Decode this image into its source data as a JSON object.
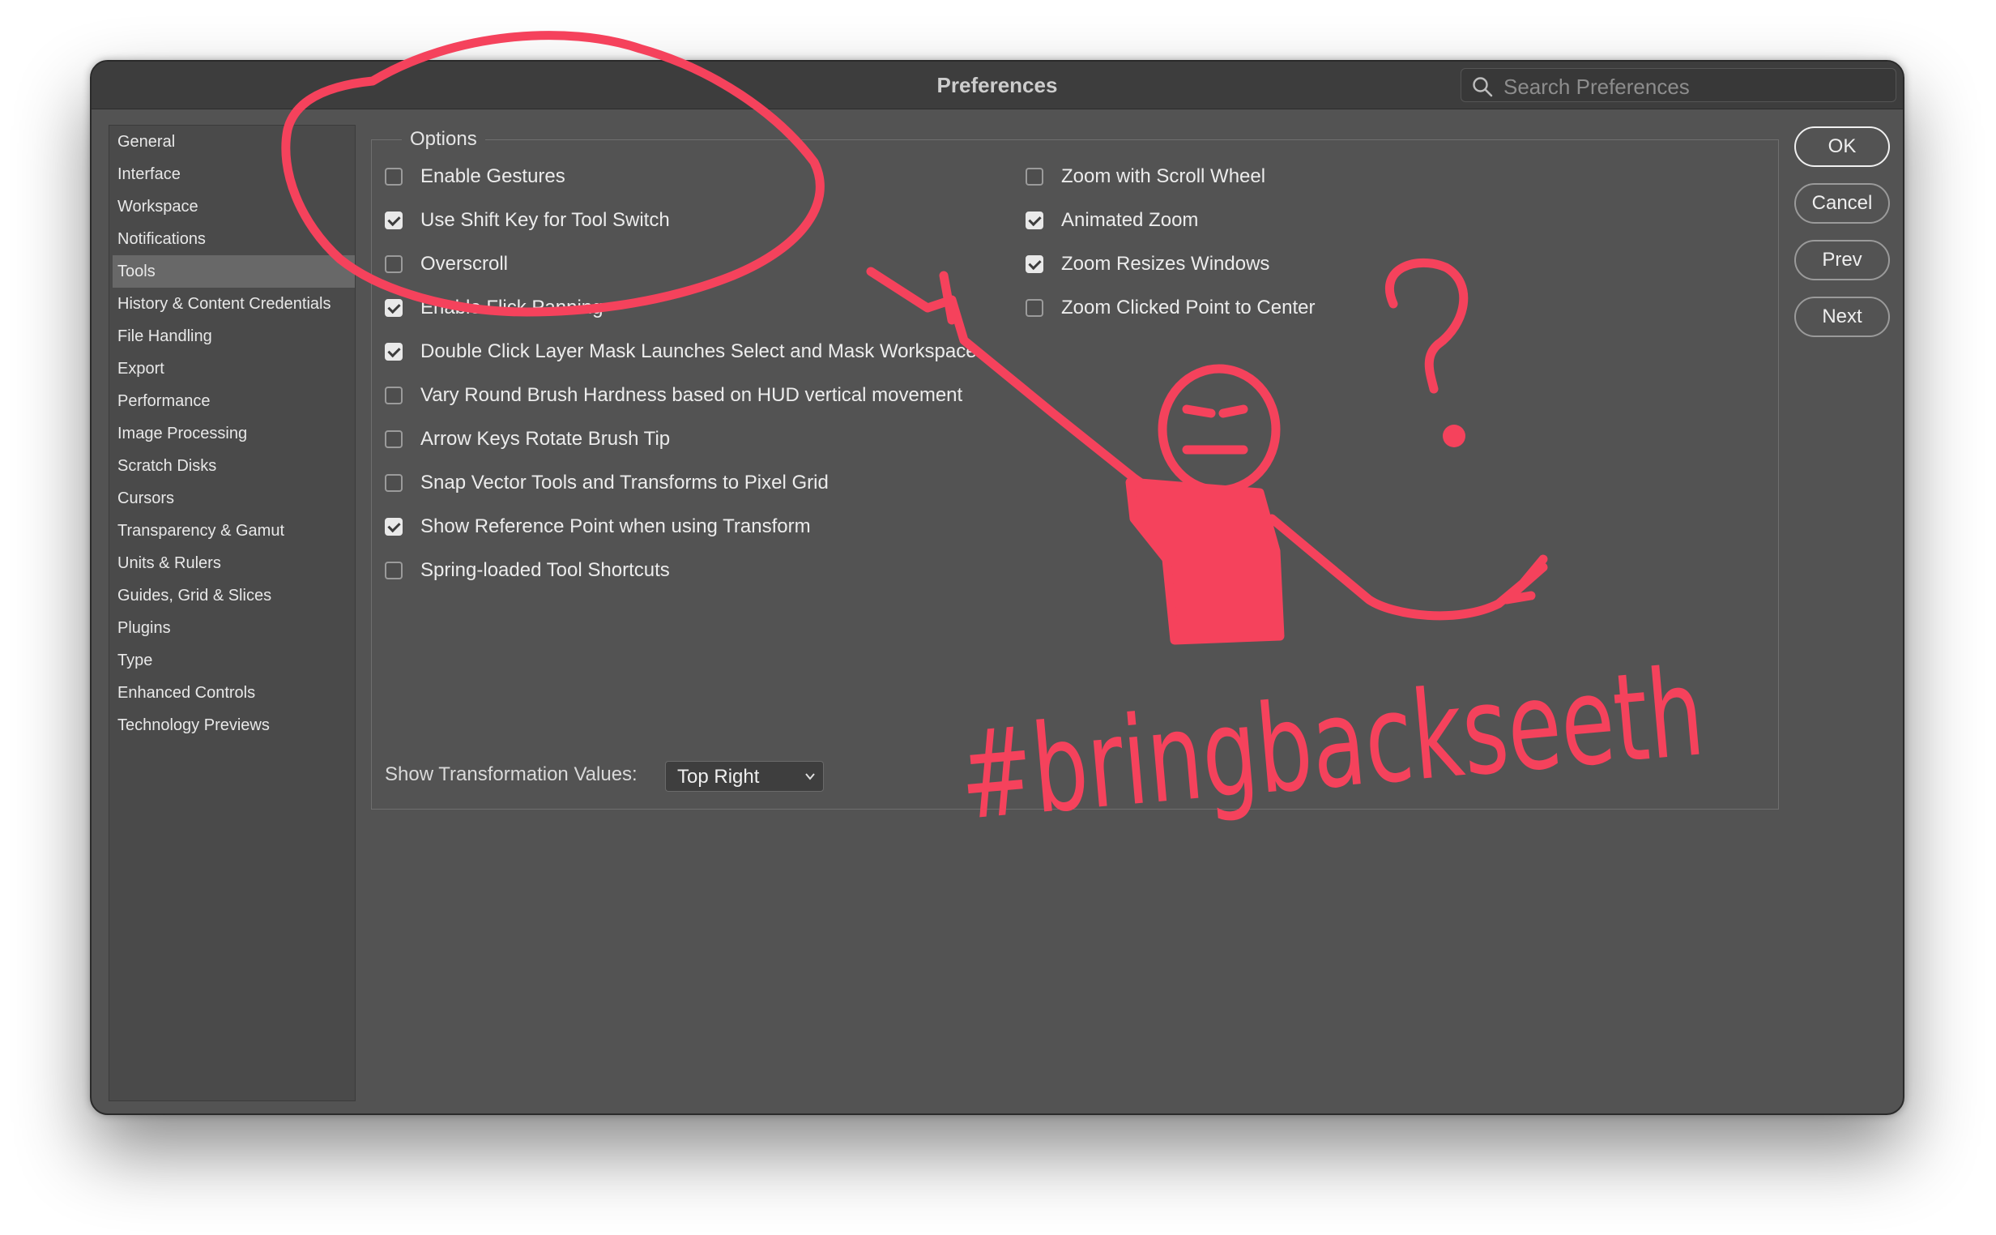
{
  "window": {
    "title": "Preferences",
    "search_placeholder": "Search Preferences"
  },
  "sidebar": {
    "items": [
      {
        "label": "General"
      },
      {
        "label": "Interface"
      },
      {
        "label": "Workspace"
      },
      {
        "label": "Notifications"
      },
      {
        "label": "Tools",
        "selected": true
      },
      {
        "label": "History & Content Credentials"
      },
      {
        "label": "File Handling"
      },
      {
        "label": "Export"
      },
      {
        "label": "Performance"
      },
      {
        "label": "Image Processing"
      },
      {
        "label": "Scratch Disks"
      },
      {
        "label": "Cursors"
      },
      {
        "label": "Transparency & Gamut"
      },
      {
        "label": "Units & Rulers"
      },
      {
        "label": "Guides, Grid & Slices"
      },
      {
        "label": "Plugins"
      },
      {
        "label": "Type"
      },
      {
        "label": "Enhanced Controls"
      },
      {
        "label": "Technology Previews"
      }
    ]
  },
  "options": {
    "legend": "Options",
    "left": [
      {
        "label": "Enable Gestures",
        "checked": false
      },
      {
        "label": "Use Shift Key for Tool Switch",
        "checked": true
      },
      {
        "label": "Overscroll",
        "checked": false
      },
      {
        "label": "Enable Flick Panning",
        "checked": true
      },
      {
        "label": "Double Click Layer Mask Launches Select and Mask Workspace",
        "checked": true
      },
      {
        "label": "Vary Round Brush Hardness based on HUD vertical movement",
        "checked": false
      },
      {
        "label": "Arrow Keys Rotate Brush Tip",
        "checked": false
      },
      {
        "label": "Snap Vector Tools and Transforms to Pixel Grid",
        "checked": false
      },
      {
        "label": "Show Reference Point when using Transform",
        "checked": true
      },
      {
        "label": "Spring-loaded Tool Shortcuts",
        "checked": false
      }
    ],
    "right": [
      {
        "label": "Zoom with Scroll Wheel",
        "checked": false
      },
      {
        "label": "Animated Zoom",
        "checked": true
      },
      {
        "label": "Zoom Resizes Windows",
        "checked": true
      },
      {
        "label": "Zoom Clicked Point to Center",
        "checked": false
      }
    ]
  },
  "transform": {
    "label": "Show Transformation Values:",
    "value": "Top Right"
  },
  "buttons": {
    "ok": "OK",
    "cancel": "Cancel",
    "prev": "Prev",
    "next": "Next"
  },
  "annotation": {
    "hashtag": "#bringbackseeth",
    "question_mark": "?",
    "ink_color": "#f5425c"
  }
}
